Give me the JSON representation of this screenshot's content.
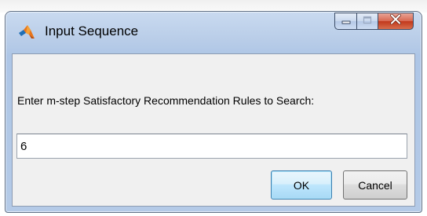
{
  "window": {
    "title": "Input Sequence",
    "app_icon": "matlab-icon",
    "caption_buttons": [
      "minimize-icon",
      "maximize-icon",
      "close-icon"
    ]
  },
  "dialog": {
    "prompt": "Enter m-step Satisfactory Recommendation Rules to Search:",
    "input_value": "6",
    "ok_label": "OK",
    "cancel_label": "Cancel"
  },
  "colors": {
    "titlebar": "#b9cde8",
    "client_background": "#f0f0f0",
    "close_button": "#c2381c",
    "ok_focus_border": "#3c7fb1"
  }
}
